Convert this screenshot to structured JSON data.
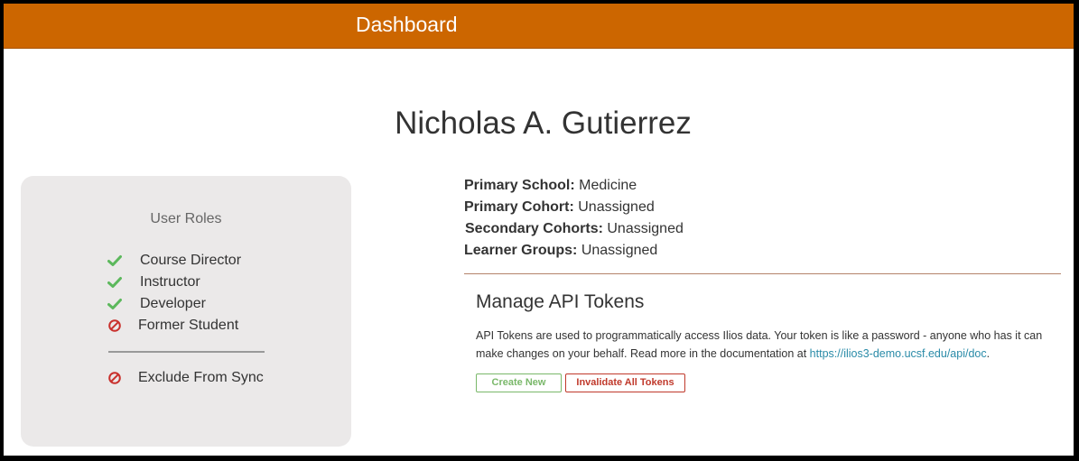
{
  "header": {
    "title": "Dashboard",
    "background": "#cc6600"
  },
  "user": {
    "name": "Nicholas A. Gutierrez"
  },
  "roles": {
    "title": "User Roles",
    "items": [
      {
        "label": "Course Director",
        "status": "check-icon",
        "color": "#5cb85c"
      },
      {
        "label": "Instructor",
        "status": "check-icon",
        "color": "#5cb85c"
      },
      {
        "label": "Developer",
        "status": "check-icon",
        "color": "#5cb85c"
      },
      {
        "label": "Former Student",
        "status": "ban-icon",
        "color": "#c9302c"
      }
    ],
    "sync": {
      "label": "Exclude From Sync",
      "status": "ban-icon",
      "color": "#c9302c"
    }
  },
  "info": {
    "primary_school": {
      "label": "Primary School:",
      "value": "Medicine"
    },
    "primary_cohort": {
      "label": "Primary Cohort:",
      "value": "Unassigned"
    },
    "secondary_cohorts": {
      "label": "Secondary Cohorts:",
      "value": "Unassigned"
    },
    "learner_groups": {
      "label": "Learner Groups:",
      "value": "Unassigned"
    }
  },
  "api": {
    "title": "Manage API Tokens",
    "description": "API Tokens are used to programmatically access Ilios data. Your token is like a password - anyone who has it can make changes on your behalf. Read more in the documentation at ",
    "doc_link": "https://ilios3-demo.ucsf.edu/api/doc",
    "description_end": ".",
    "create_label": "Create New",
    "invalidate_label": "Invalidate All Tokens"
  }
}
